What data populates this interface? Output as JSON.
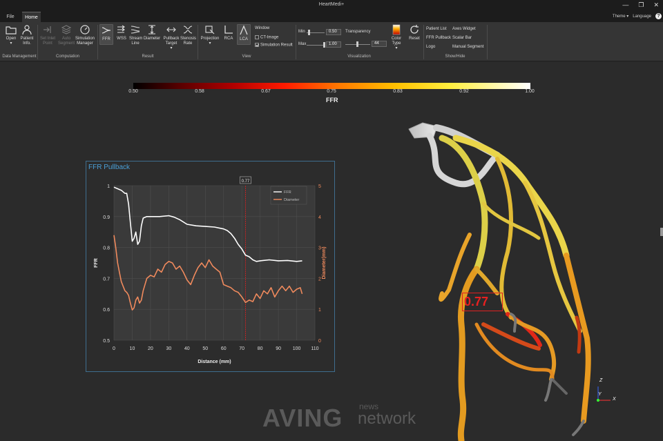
{
  "app_title": "HeartMedi+",
  "tabs": {
    "file": "File",
    "home": "Home"
  },
  "top_right": {
    "theme": "Theme",
    "language": "Language",
    "help": "?"
  },
  "ribbon": {
    "data_management": {
      "group": "Data Management",
      "open": "Open",
      "patient_info": "Patient Info."
    },
    "computation": {
      "group": "Computation",
      "set_inlet_point": "Set Inlet Point",
      "auto_segment": "Auto Segment",
      "simulation_manager": "Simulation Manager"
    },
    "result": {
      "group": "Result",
      "ffr": "FFR",
      "wss": "WSS",
      "stream_line": "Stream Line",
      "diameter": "Diameter",
      "pullback_target": "Pullback Target",
      "stenosis_rate": "Stenosis Rate"
    },
    "view": {
      "group": "View",
      "projection": "Projection",
      "rca": "RCA",
      "lca": "LCA",
      "window": "Window",
      "ct_image": "CT-Image",
      "simulation_result": "Simulation Result",
      "ct_image_checked": false,
      "simulation_result_checked": true
    },
    "visualization": {
      "group": "Visualization",
      "min_label": "Min",
      "min_value": "0.50",
      "max_label": "Max",
      "max_value": "1.00",
      "transparency_label": "Transparency",
      "transparency_value": "44",
      "color_type": "Color Type",
      "reset": "Reset"
    },
    "show_hide": {
      "group": "Show/Hide",
      "patient_list": "Patient List",
      "ffr_pullback": "FFR Pullback",
      "logo": "Logo",
      "axes_widget": "Axes Widget",
      "scalar_bar": "Scalar Bar",
      "manual_segment": "Manual Segment"
    }
  },
  "colorbar": {
    "title": "FFR",
    "ticks": [
      "0.50",
      "0.58",
      "0.67",
      "0.75",
      "0.83",
      "0.92",
      "1.00"
    ]
  },
  "pullback_panel": {
    "title": "FFR Pullback"
  },
  "chart_data": {
    "type": "line",
    "xlabel": "Distance (mm)",
    "ylabel_left": "FFR",
    "ylabel_right": "Diameter(mm)",
    "x_ticks": [
      0,
      10,
      20,
      30,
      40,
      50,
      60,
      70,
      80,
      90,
      100,
      110
    ],
    "y_left_ticks": [
      0.5,
      0.6,
      0.7,
      0.8,
      0.9,
      1
    ],
    "y_right_ticks": [
      0,
      1,
      2,
      3,
      4,
      5
    ],
    "xlim": [
      0,
      110
    ],
    "ylim_left": [
      0.5,
      1.0
    ],
    "ylim_right": [
      0,
      5
    ],
    "marker": {
      "x": 72,
      "label": "0.77"
    },
    "legend_position": "top-right",
    "series": [
      {
        "name": "FFR",
        "axis": "left",
        "color": "#ffffff",
        "x": [
          0,
          2,
          4,
          6,
          7,
          8,
          9,
          10,
          11,
          12,
          13,
          14,
          15,
          16,
          18,
          20,
          25,
          30,
          33,
          36,
          40,
          45,
          50,
          55,
          60,
          62,
          64,
          66,
          68,
          70,
          72,
          74,
          76,
          78,
          80,
          85,
          90,
          95,
          100,
          103
        ],
        "y": [
          0.995,
          0.99,
          0.985,
          0.975,
          0.975,
          0.94,
          0.88,
          0.82,
          0.83,
          0.85,
          0.81,
          0.82,
          0.87,
          0.895,
          0.9,
          0.9,
          0.9,
          0.903,
          0.898,
          0.89,
          0.875,
          0.87,
          0.868,
          0.866,
          0.86,
          0.855,
          0.845,
          0.83,
          0.81,
          0.795,
          0.775,
          0.77,
          0.76,
          0.755,
          0.757,
          0.76,
          0.757,
          0.758,
          0.755,
          0.757
        ]
      },
      {
        "name": "Diameter",
        "axis": "right",
        "color": "#f08a5d",
        "x": [
          0,
          1,
          2,
          3,
          4,
          5,
          6,
          7,
          8,
          9,
          10,
          11,
          12,
          13,
          14,
          15,
          16,
          18,
          20,
          22,
          24,
          26,
          28,
          30,
          32,
          34,
          36,
          38,
          40,
          42,
          44,
          46,
          48,
          50,
          52,
          54,
          56,
          58,
          60,
          62,
          64,
          66,
          68,
          70,
          72,
          74,
          76,
          78,
          80,
          82,
          84,
          86,
          88,
          90,
          92,
          94,
          96,
          98,
          100,
          102,
          103
        ],
        "y": [
          3.4,
          3.0,
          2.5,
          2.2,
          1.9,
          1.75,
          1.6,
          1.55,
          1.45,
          1.2,
          0.98,
          1.05,
          1.3,
          1.4,
          1.2,
          1.3,
          1.6,
          2.0,
          2.1,
          2.05,
          2.3,
          2.2,
          2.45,
          2.55,
          2.5,
          2.3,
          2.4,
          2.2,
          1.95,
          1.8,
          2.1,
          2.35,
          2.5,
          2.35,
          2.6,
          2.4,
          2.3,
          2.2,
          1.8,
          1.75,
          1.7,
          1.6,
          1.55,
          1.4,
          1.22,
          1.3,
          1.25,
          1.5,
          1.35,
          1.6,
          1.5,
          1.7,
          1.4,
          1.6,
          1.75,
          1.6,
          1.75,
          1.55,
          1.65,
          1.7,
          1.5
        ]
      }
    ]
  },
  "vessel_label": "0.77",
  "axes": {
    "z": "Z",
    "y": "Y",
    "x": "X"
  },
  "watermark": {
    "main": "AVING",
    "sub": "news",
    "net": "network"
  }
}
